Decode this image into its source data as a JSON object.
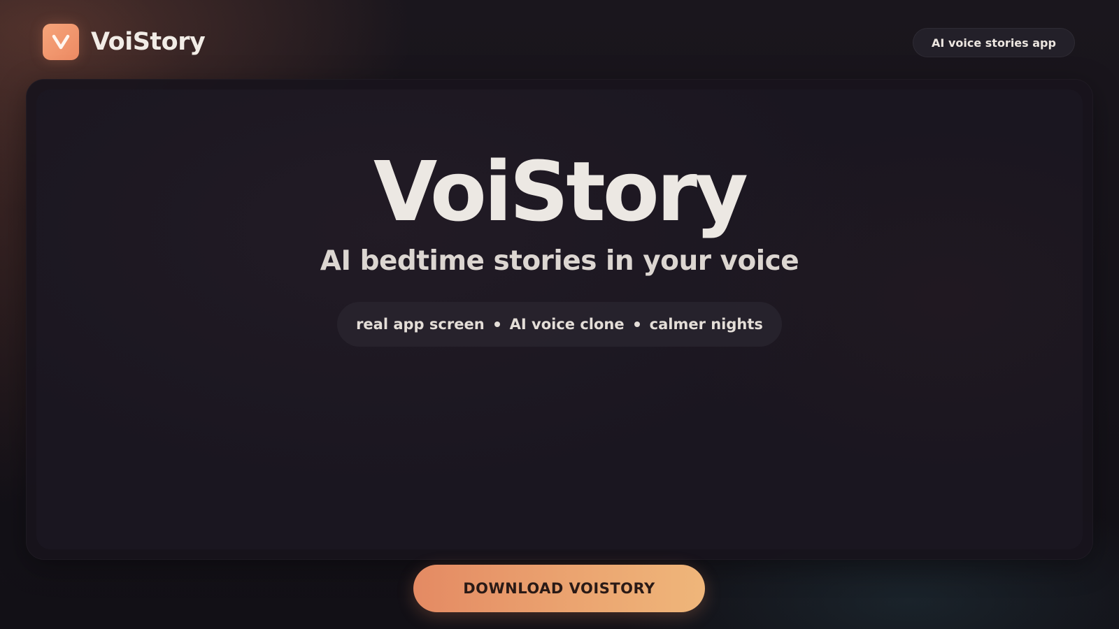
{
  "brand": {
    "name": "VoiStory",
    "logo_letter": "V",
    "logo_icon": "v-letter-logo-icon",
    "accent_color": "#ec8a63"
  },
  "header": {
    "badge_label": "AI voice stories app"
  },
  "hero": {
    "title": "VoiStory",
    "subtitle": "AI bedtime stories in your voice",
    "tags": [
      "real app screen",
      "AI voice clone",
      "calmer nights"
    ]
  },
  "cta": {
    "label": "DOWNLOAD VOISTORY"
  },
  "colors": {
    "background": "#15121a",
    "card": "#1a1620",
    "text": "#ece8e3",
    "cta_start": "#e48a63",
    "cta_end": "#efb67a"
  }
}
